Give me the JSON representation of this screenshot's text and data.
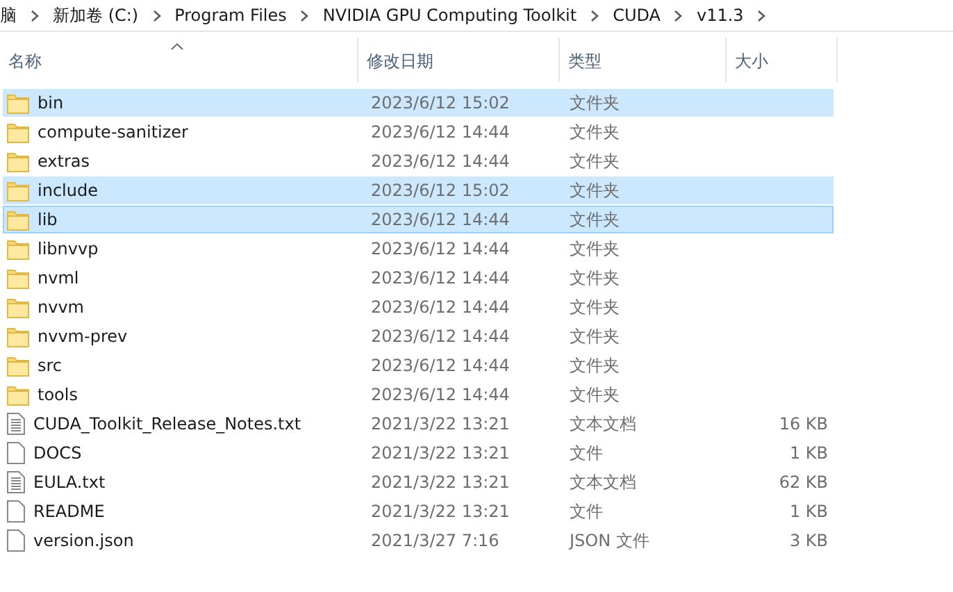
{
  "breadcrumb": [
    "脑",
    "新加卷 (C:)",
    "Program Files",
    "NVIDIA GPU Computing Toolkit",
    "CUDA",
    "v11.3"
  ],
  "columns": [
    {
      "label": "名称",
      "sorted": true
    },
    {
      "label": "修改日期",
      "sorted": false
    },
    {
      "label": "类型",
      "sorted": false
    },
    {
      "label": "大小",
      "sorted": false
    }
  ],
  "rows": [
    {
      "kind": "folder",
      "name": "bin",
      "date": "2023/6/12 15:02",
      "type": "文件夹",
      "selected": true,
      "focused": false
    },
    {
      "kind": "folder",
      "name": "compute-sanitizer",
      "date": "2023/6/12 14:44",
      "type": "文件夹",
      "selected": false,
      "focused": false
    },
    {
      "kind": "folder",
      "name": "extras",
      "date": "2023/6/12 14:44",
      "type": "文件夹",
      "selected": false,
      "focused": false
    },
    {
      "kind": "folder",
      "name": "include",
      "date": "2023/6/12 15:02",
      "type": "文件夹",
      "selected": true,
      "focused": false
    },
    {
      "kind": "folder",
      "name": "lib",
      "date": "2023/6/12 14:44",
      "type": "文件夹",
      "selected": true,
      "focused": true
    },
    {
      "kind": "folder",
      "name": "libnvvp",
      "date": "2023/6/12 14:44",
      "type": "文件夹",
      "selected": false,
      "focused": false
    },
    {
      "kind": "folder",
      "name": "nvml",
      "date": "2023/6/12 14:44",
      "type": "文件夹",
      "selected": false,
      "focused": false
    },
    {
      "kind": "folder",
      "name": "nvvm",
      "date": "2023/6/12 14:44",
      "type": "文件夹",
      "selected": false,
      "focused": false
    },
    {
      "kind": "folder",
      "name": "nvvm-prev",
      "date": "2023/6/12 14:44",
      "type": "文件夹",
      "selected": false,
      "focused": false
    },
    {
      "kind": "folder",
      "name": "src",
      "date": "2023/6/12 14:44",
      "type": "文件夹",
      "selected": false,
      "focused": false
    },
    {
      "kind": "folder",
      "name": "tools",
      "date": "2023/6/12 14:44",
      "type": "文件夹",
      "selected": false,
      "focused": false
    },
    {
      "kind": "text",
      "name": "CUDA_Toolkit_Release_Notes.txt",
      "date": "2021/3/22 13:21",
      "type": "文本文档",
      "size": "16 KB",
      "selected": false,
      "focused": false
    },
    {
      "kind": "file",
      "name": "DOCS",
      "date": "2021/3/22 13:21",
      "type": "文件",
      "size": "1 KB",
      "selected": false,
      "focused": false
    },
    {
      "kind": "text",
      "name": "EULA.txt",
      "date": "2021/3/22 13:21",
      "type": "文本文档",
      "size": "62 KB",
      "selected": false,
      "focused": false
    },
    {
      "kind": "file",
      "name": "README",
      "date": "2021/3/22 13:21",
      "type": "文件",
      "size": "1 KB",
      "selected": false,
      "focused": false
    },
    {
      "kind": "file",
      "name": "version.json",
      "date": "2021/3/27 7:16",
      "type": "JSON 文件",
      "size": "3 KB",
      "selected": false,
      "focused": false
    }
  ]
}
